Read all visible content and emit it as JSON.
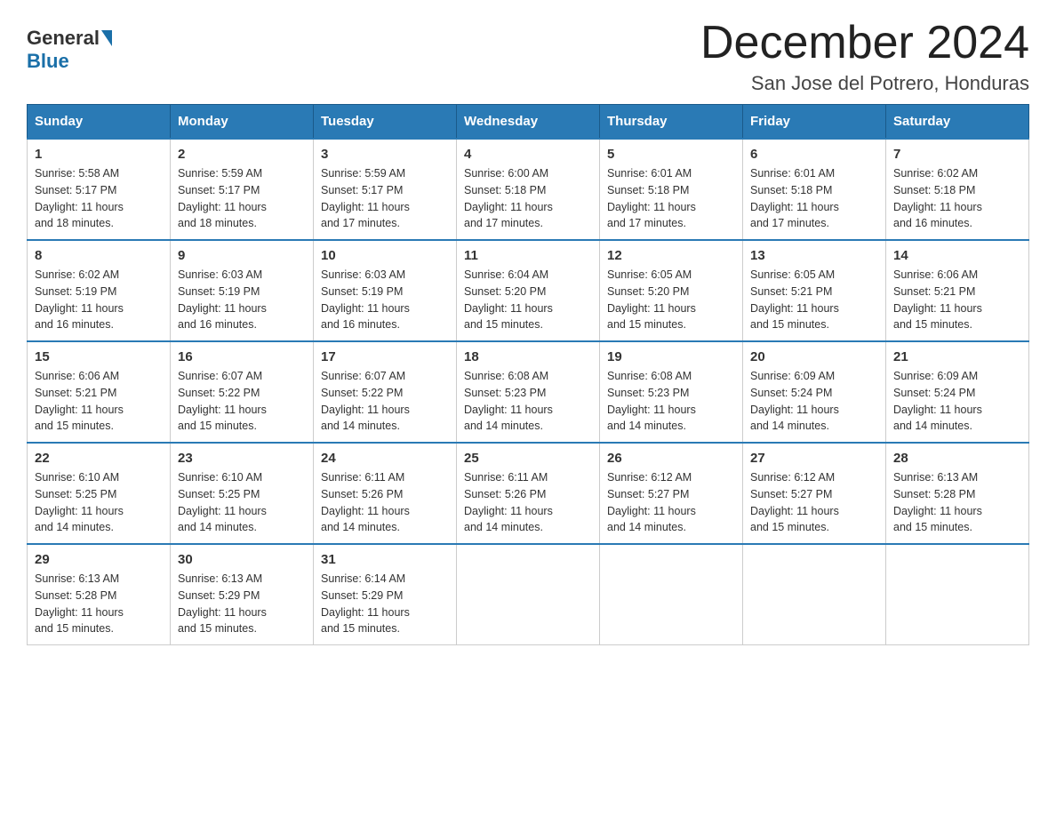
{
  "logo": {
    "general": "General",
    "blue": "Blue"
  },
  "header": {
    "title": "December 2024",
    "location": "San Jose del Potrero, Honduras"
  },
  "days_of_week": [
    "Sunday",
    "Monday",
    "Tuesday",
    "Wednesday",
    "Thursday",
    "Friday",
    "Saturday"
  ],
  "weeks": [
    [
      {
        "day": "1",
        "sunrise": "5:58 AM",
        "sunset": "5:17 PM",
        "daylight": "11 hours and 18 minutes."
      },
      {
        "day": "2",
        "sunrise": "5:59 AM",
        "sunset": "5:17 PM",
        "daylight": "11 hours and 18 minutes."
      },
      {
        "day": "3",
        "sunrise": "5:59 AM",
        "sunset": "5:17 PM",
        "daylight": "11 hours and 17 minutes."
      },
      {
        "day": "4",
        "sunrise": "6:00 AM",
        "sunset": "5:18 PM",
        "daylight": "11 hours and 17 minutes."
      },
      {
        "day": "5",
        "sunrise": "6:01 AM",
        "sunset": "5:18 PM",
        "daylight": "11 hours and 17 minutes."
      },
      {
        "day": "6",
        "sunrise": "6:01 AM",
        "sunset": "5:18 PM",
        "daylight": "11 hours and 17 minutes."
      },
      {
        "day": "7",
        "sunrise": "6:02 AM",
        "sunset": "5:18 PM",
        "daylight": "11 hours and 16 minutes."
      }
    ],
    [
      {
        "day": "8",
        "sunrise": "6:02 AM",
        "sunset": "5:19 PM",
        "daylight": "11 hours and 16 minutes."
      },
      {
        "day": "9",
        "sunrise": "6:03 AM",
        "sunset": "5:19 PM",
        "daylight": "11 hours and 16 minutes."
      },
      {
        "day": "10",
        "sunrise": "6:03 AM",
        "sunset": "5:19 PM",
        "daylight": "11 hours and 16 minutes."
      },
      {
        "day": "11",
        "sunrise": "6:04 AM",
        "sunset": "5:20 PM",
        "daylight": "11 hours and 15 minutes."
      },
      {
        "day": "12",
        "sunrise": "6:05 AM",
        "sunset": "5:20 PM",
        "daylight": "11 hours and 15 minutes."
      },
      {
        "day": "13",
        "sunrise": "6:05 AM",
        "sunset": "5:21 PM",
        "daylight": "11 hours and 15 minutes."
      },
      {
        "day": "14",
        "sunrise": "6:06 AM",
        "sunset": "5:21 PM",
        "daylight": "11 hours and 15 minutes."
      }
    ],
    [
      {
        "day": "15",
        "sunrise": "6:06 AM",
        "sunset": "5:21 PM",
        "daylight": "11 hours and 15 minutes."
      },
      {
        "day": "16",
        "sunrise": "6:07 AM",
        "sunset": "5:22 PM",
        "daylight": "11 hours and 15 minutes."
      },
      {
        "day": "17",
        "sunrise": "6:07 AM",
        "sunset": "5:22 PM",
        "daylight": "11 hours and 14 minutes."
      },
      {
        "day": "18",
        "sunrise": "6:08 AM",
        "sunset": "5:23 PM",
        "daylight": "11 hours and 14 minutes."
      },
      {
        "day": "19",
        "sunrise": "6:08 AM",
        "sunset": "5:23 PM",
        "daylight": "11 hours and 14 minutes."
      },
      {
        "day": "20",
        "sunrise": "6:09 AM",
        "sunset": "5:24 PM",
        "daylight": "11 hours and 14 minutes."
      },
      {
        "day": "21",
        "sunrise": "6:09 AM",
        "sunset": "5:24 PM",
        "daylight": "11 hours and 14 minutes."
      }
    ],
    [
      {
        "day": "22",
        "sunrise": "6:10 AM",
        "sunset": "5:25 PM",
        "daylight": "11 hours and 14 minutes."
      },
      {
        "day": "23",
        "sunrise": "6:10 AM",
        "sunset": "5:25 PM",
        "daylight": "11 hours and 14 minutes."
      },
      {
        "day": "24",
        "sunrise": "6:11 AM",
        "sunset": "5:26 PM",
        "daylight": "11 hours and 14 minutes."
      },
      {
        "day": "25",
        "sunrise": "6:11 AM",
        "sunset": "5:26 PM",
        "daylight": "11 hours and 14 minutes."
      },
      {
        "day": "26",
        "sunrise": "6:12 AM",
        "sunset": "5:27 PM",
        "daylight": "11 hours and 14 minutes."
      },
      {
        "day": "27",
        "sunrise": "6:12 AM",
        "sunset": "5:27 PM",
        "daylight": "11 hours and 15 minutes."
      },
      {
        "day": "28",
        "sunrise": "6:13 AM",
        "sunset": "5:28 PM",
        "daylight": "11 hours and 15 minutes."
      }
    ],
    [
      {
        "day": "29",
        "sunrise": "6:13 AM",
        "sunset": "5:28 PM",
        "daylight": "11 hours and 15 minutes."
      },
      {
        "day": "30",
        "sunrise": "6:13 AM",
        "sunset": "5:29 PM",
        "daylight": "11 hours and 15 minutes."
      },
      {
        "day": "31",
        "sunrise": "6:14 AM",
        "sunset": "5:29 PM",
        "daylight": "11 hours and 15 minutes."
      },
      null,
      null,
      null,
      null
    ]
  ]
}
